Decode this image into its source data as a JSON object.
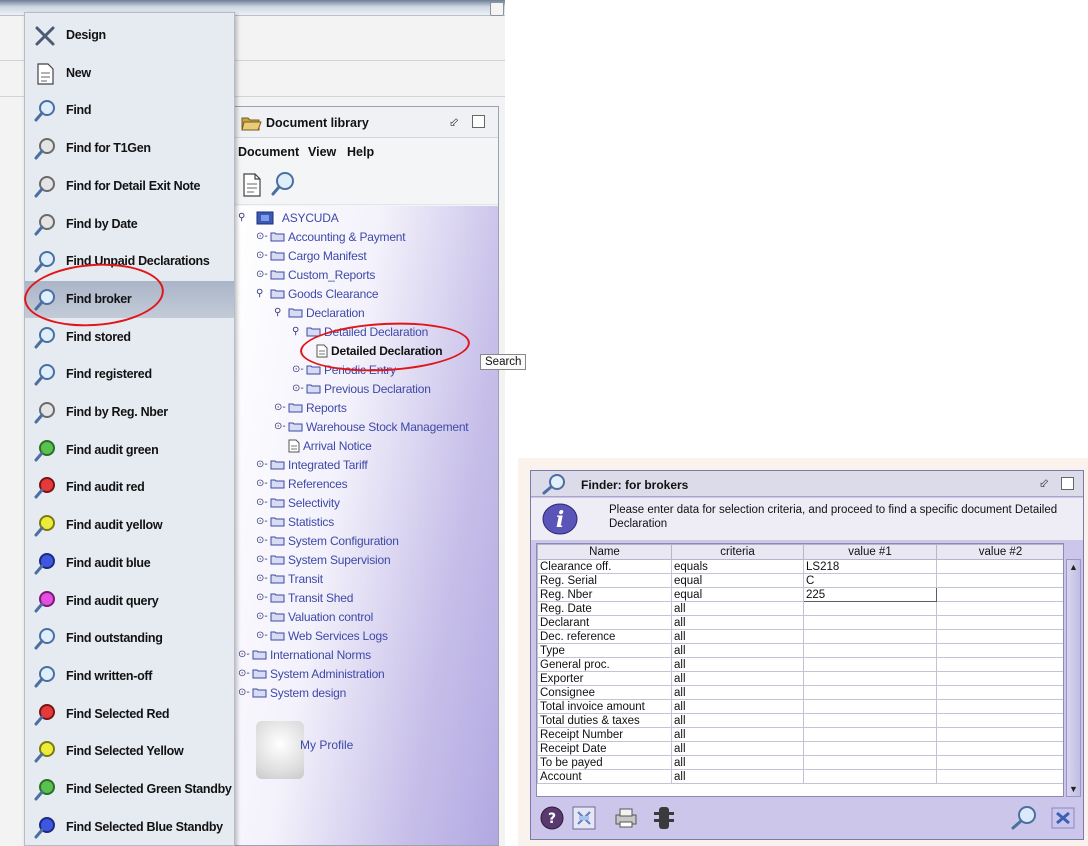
{
  "menu": {
    "items": [
      {
        "label": "Design",
        "icon": "design-icon"
      },
      {
        "label": "New",
        "icon": "new-document-icon"
      },
      {
        "label": "Find",
        "icon": "find-icon"
      },
      {
        "label": "Find for T1Gen",
        "icon": "find-gray-icon"
      },
      {
        "label": "Find for Detail Exit Note",
        "icon": "find-gray-icon"
      },
      {
        "label": "Find by Date",
        "icon": "find-gray-icon"
      },
      {
        "label": "Find Unpaid Declarations",
        "icon": "find-icon"
      },
      {
        "label": "Find broker",
        "icon": "find-icon"
      },
      {
        "label": "Find stored",
        "icon": "find-icon"
      },
      {
        "label": "Find registered",
        "icon": "find-icon"
      },
      {
        "label": "Find by Reg. Nber",
        "icon": "find-gray-icon"
      },
      {
        "label": "Find audit green",
        "icon": "find-green-icon"
      },
      {
        "label": "Find audit red",
        "icon": "find-red-icon"
      },
      {
        "label": "Find audit yellow",
        "icon": "find-yellow-icon"
      },
      {
        "label": "Find audit blue",
        "icon": "find-blue-icon"
      },
      {
        "label": "Find audit query",
        "icon": "find-magenta-icon"
      },
      {
        "label": "Find outstanding",
        "icon": "find-icon"
      },
      {
        "label": "Find written-off",
        "icon": "find-icon"
      },
      {
        "label": "Find Selected Red",
        "icon": "find-red-icon"
      },
      {
        "label": "Find Selected Yellow",
        "icon": "find-yellow-icon"
      },
      {
        "label": "Find Selected Green Standby",
        "icon": "find-green-icon"
      },
      {
        "label": "Find Selected Blue Standby",
        "icon": "find-blue-icon"
      }
    ],
    "selected": "Find broker"
  },
  "doclib": {
    "title": "Document library",
    "menubar": [
      "Document",
      "View",
      "Help"
    ],
    "tree": [
      {
        "label": "ASYCUDA",
        "state": "open",
        "icon": "asycuda-icon"
      },
      {
        "label": "Accounting & Payment",
        "state": "closed"
      },
      {
        "label": "Cargo Manifest",
        "state": "closed"
      },
      {
        "label": "Custom_Reports",
        "state": "closed"
      },
      {
        "label": "Goods Clearance",
        "state": "open"
      },
      {
        "label": "Declaration",
        "state": "open"
      },
      {
        "label": "Detailed Declaration",
        "state": "open"
      },
      {
        "label": "Detailed Declaration",
        "state": "leaf",
        "selected": true
      },
      {
        "label": "Periodic Entry",
        "state": "closed"
      },
      {
        "label": "Previous Declaration",
        "state": "closed"
      },
      {
        "label": "Reports",
        "state": "closed"
      },
      {
        "label": "Warehouse Stock Management",
        "state": "closed"
      },
      {
        "label": "Arrival Notice",
        "state": "leaf"
      },
      {
        "label": "Integrated Tariff",
        "state": "closed"
      },
      {
        "label": "References",
        "state": "closed"
      },
      {
        "label": "Selectivity",
        "state": "closed"
      },
      {
        "label": "Statistics",
        "state": "closed"
      },
      {
        "label": "System Configuration",
        "state": "closed"
      },
      {
        "label": "System Supervision",
        "state": "closed"
      },
      {
        "label": "Transit",
        "state": "closed"
      },
      {
        "label": "Transit Shed",
        "state": "closed"
      },
      {
        "label": "Valuation control",
        "state": "closed"
      },
      {
        "label": "Web Services Logs",
        "state": "closed"
      },
      {
        "label": "International Norms",
        "state": "closed"
      },
      {
        "label": "System Administration",
        "state": "closed"
      },
      {
        "label": "System design",
        "state": "closed"
      }
    ],
    "profile_label": "My Profile"
  },
  "finder": {
    "title": "Finder: for brokers",
    "message": "Please enter data for selection criteria, and proceed to find a specific document Detailed Declaration",
    "columns": [
      "Name",
      "criteria",
      "value #1",
      "value #2"
    ],
    "rows": [
      [
        "Clearance off.",
        "equals",
        "LS218",
        ""
      ],
      [
        "Reg. Serial",
        "equal",
        "C",
        ""
      ],
      [
        "Reg. Nber",
        "equal",
        "225",
        ""
      ],
      [
        "Reg. Date",
        "all",
        "",
        ""
      ],
      [
        "Declarant",
        "all",
        "",
        ""
      ],
      [
        "Dec. reference",
        "all",
        "",
        ""
      ],
      [
        "Type",
        "all",
        "",
        ""
      ],
      [
        "General proc.",
        "all",
        "",
        ""
      ],
      [
        "Exporter",
        "all",
        "",
        ""
      ],
      [
        "Consignee",
        "all",
        "",
        ""
      ],
      [
        "Total invoice amount",
        "all",
        "",
        ""
      ],
      [
        "Total duties & taxes",
        "all",
        "",
        ""
      ],
      [
        "Receipt Number",
        "all",
        "",
        ""
      ],
      [
        "Receipt Date",
        "all",
        "",
        ""
      ],
      [
        "To be payed",
        "all",
        "",
        ""
      ],
      [
        "Account",
        "all",
        "",
        ""
      ]
    ],
    "tooltip": "Search",
    "colors": {
      "window_bg": "#ccc7ea",
      "annotation": "#e0161b",
      "tree_text": "#3e49a8"
    }
  }
}
